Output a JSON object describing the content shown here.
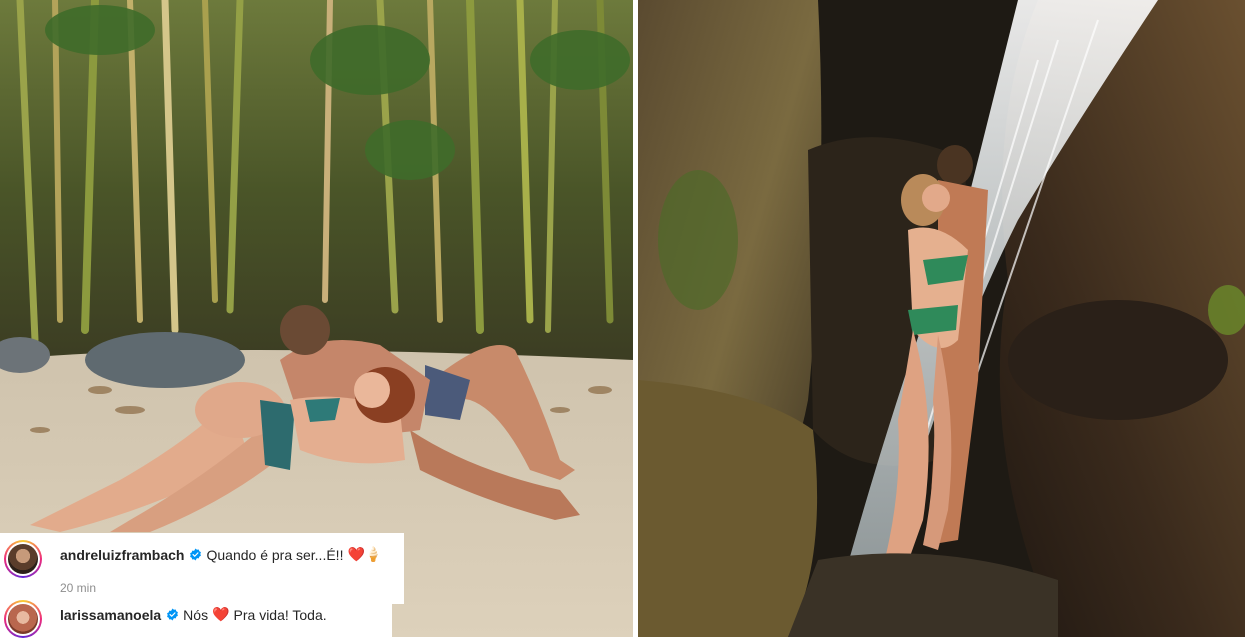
{
  "comments": [
    {
      "username": "andreluizframbach",
      "text": "Quando é pra ser...É!!",
      "emoji": "❤️🍦",
      "time": "20 min"
    },
    {
      "username": "larissamanoela",
      "text_before": "Nós",
      "heart": "❤️",
      "text_after": "Pra vida! Toda."
    }
  ],
  "icons": {
    "verified": "verified-badge-icon"
  },
  "colors": {
    "verified_blue": "#0095f6",
    "heart_red": "#e0245e",
    "muted_gray": "#8e8e8e"
  }
}
